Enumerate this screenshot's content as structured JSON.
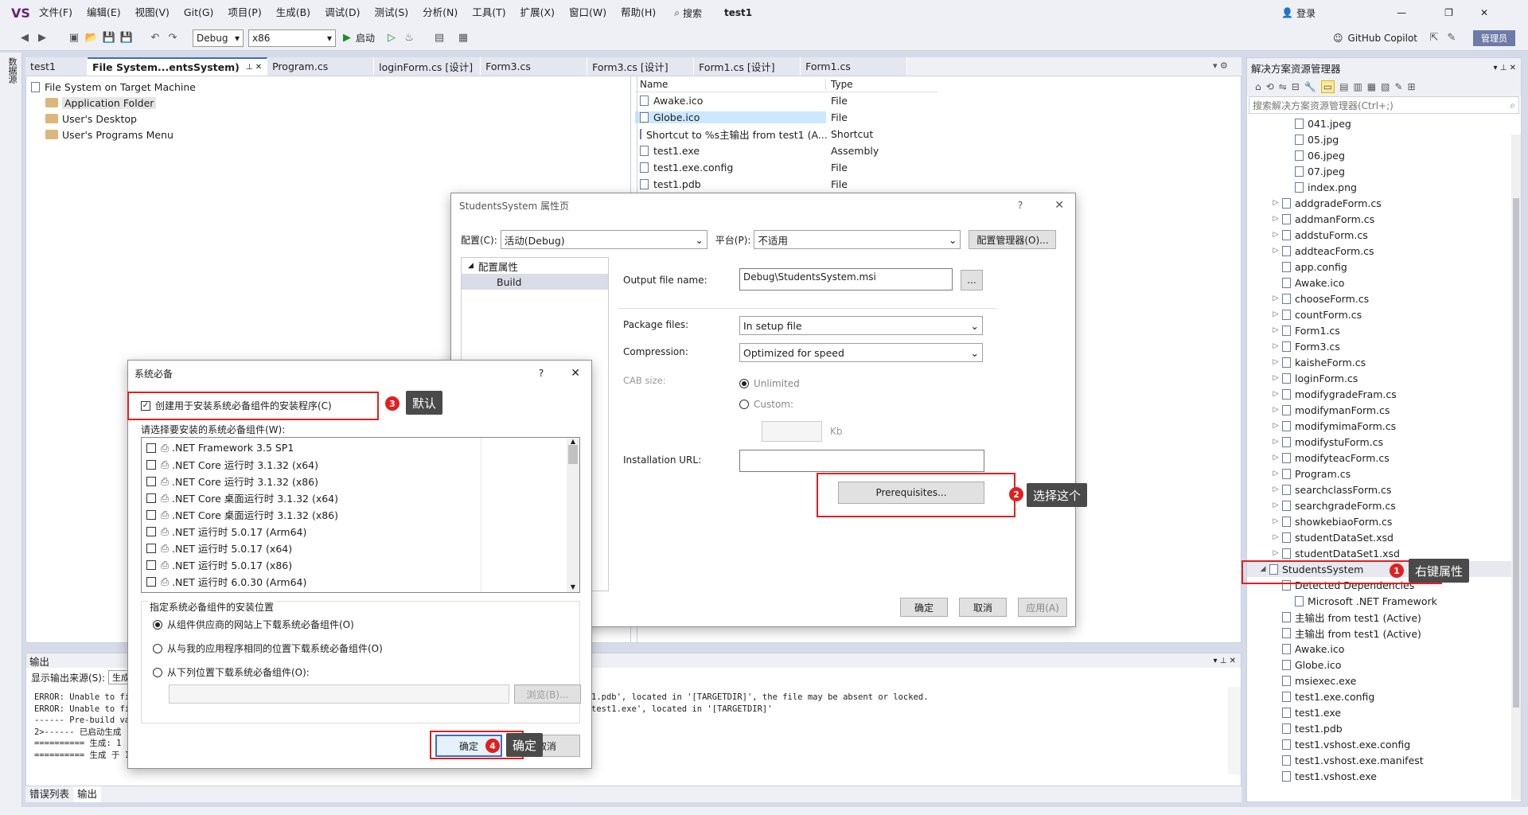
{
  "menubar": {
    "logo": "VS",
    "items": [
      "文件(F)",
      "编辑(E)",
      "视图(V)",
      "Git(G)",
      "项目(P)",
      "生成(B)",
      "调试(D)",
      "测试(S)",
      "分析(N)",
      "工具(T)",
      "扩展(X)",
      "窗口(W)",
      "帮助(H)"
    ],
    "search": "搜索",
    "solution_name": "test1",
    "login": "登录",
    "copilot": "GitHub Copilot",
    "admin": "管理员"
  },
  "toolbar": {
    "config": "Debug",
    "platform": "x86",
    "start": "启动"
  },
  "sidetab_label": "数据源",
  "doc_tabs": [
    {
      "label": "test1",
      "active": false
    },
    {
      "label": "File System...entsSystem)",
      "active": true
    },
    {
      "label": "Program.cs",
      "active": false
    },
    {
      "label": "loginForm.cs [设计]",
      "active": false
    },
    {
      "label": "Form3.cs",
      "active": false
    },
    {
      "label": "Form3.cs [设计]",
      "active": false
    },
    {
      "label": "Form1.cs [设计]",
      "active": false
    },
    {
      "label": "Form1.cs",
      "active": false
    }
  ],
  "fs_tree": {
    "root": "File System on Target Machine",
    "items": [
      "Application Folder",
      "User's Desktop",
      "User's Programs Menu"
    ]
  },
  "file_list": {
    "headers": [
      "Name",
      "Type"
    ],
    "rows": [
      {
        "name": "Awake.ico",
        "type": "File"
      },
      {
        "name": "Globe.ico",
        "type": "File"
      },
      {
        "name": "Shortcut to %s主输出 from test1 (A...",
        "type": "Shortcut"
      },
      {
        "name": "test1.exe",
        "type": "Assembly"
      },
      {
        "name": "test1.exe.config",
        "type": "File"
      },
      {
        "name": "test1.pdb",
        "type": "File"
      }
    ]
  },
  "props_dialog": {
    "title": "StudentsSystem 属性页",
    "help": "?",
    "close": "✕",
    "config_label": "配置(C):",
    "config_value": "活动(Debug)",
    "platform_label": "平台(P):",
    "platform_value": "不适用",
    "config_manager": "配置管理器(O)...",
    "tree_root": "配置属性",
    "tree_child": "Build",
    "output_label": "Output file name:",
    "output_value": "Debug\\StudentsSystem.msi",
    "browse": "...",
    "package_label": "Package files:",
    "package_value": "In setup file",
    "compression_label": "Compression:",
    "compression_value": "Optimized for speed",
    "cab_label": "CAB size:",
    "unlimited": "Unlimited",
    "custom": "Custom:",
    "kb": "Kb",
    "install_url_label": "Installation URL:",
    "prereq_button": "Prerequisites...",
    "ok": "确定",
    "cancel": "取消",
    "apply": "应用(A)"
  },
  "prereq_dialog": {
    "title": "系统必备",
    "help": "?",
    "close": "✕",
    "create_setup": "创建用于安装系统必备组件的安装程序(C)",
    "choose_label": "请选择要安装的系统必备组件(W):",
    "components": [
      ".NET Framework 3.5 SP1",
      ".NET Core 运行时 3.1.32 (x64)",
      ".NET Core 运行时 3.1.32 (x86)",
      ".NET Core 桌面运行时 3.1.32 (x64)",
      ".NET Core 桌面运行时 3.1.32 (x86)",
      ".NET 运行时 5.0.17 (Arm64)",
      ".NET 运行时 5.0.17 (x64)",
      ".NET 运行时 5.0.17 (x86)",
      ".NET 运行时 6.0.30 (Arm64)"
    ],
    "location_group": "指定系统必备组件的安装位置",
    "opt1": "从组件供应商的网站上下载系统必备组件(O)",
    "opt2": "从与我的应用程序相同的位置下载系统必备组件(O)",
    "opt3": "从下列位置下载系统必备组件(O):",
    "browse": "浏览(B)...",
    "ok": "确定",
    "cancel": "取消"
  },
  "output": {
    "title": "输出",
    "source_label": "显示输出来源(S):",
    "source_value": "生成",
    "lines_left": [
      "ERROR: Unable to fin",
      "ERROR: Unable to fin",
      "------ Pre-build val",
      "2>------ 已启动生成",
      "========== 生成: 1 ",
      "========== 生成 于 1"
    ],
    "lines_right": [
      "1.pdb', located in '[TARGETDIR]', the file may be absent or locked.",
      "test1.exe', located in '[TARGETDIR]'"
    ]
  },
  "bottom_tabs": [
    "错误列表",
    "输出"
  ],
  "solution_explorer": {
    "title": "解决方案资源管理器",
    "search_placeholder": "搜索解决方案资源管理器(Ctrl+;)",
    "items": [
      {
        "label": "041.jpeg",
        "level": 3,
        "expand": false
      },
      {
        "label": "05.jpg",
        "level": 3,
        "expand": false
      },
      {
        "label": "06.jpeg",
        "level": 3,
        "expand": false
      },
      {
        "label": "07.jpeg",
        "level": 3,
        "expand": false
      },
      {
        "label": "index.png",
        "level": 3,
        "expand": false
      },
      {
        "label": "addgradeForm.cs",
        "level": 2,
        "expand": true
      },
      {
        "label": "addmanForm.cs",
        "level": 2,
        "expand": true
      },
      {
        "label": "addstuForm.cs",
        "level": 2,
        "expand": true
      },
      {
        "label": "addteacForm.cs",
        "level": 2,
        "expand": true
      },
      {
        "label": "app.config",
        "level": 2,
        "expand": false
      },
      {
        "label": "Awake.ico",
        "level": 2,
        "expand": false
      },
      {
        "label": "chooseForm.cs",
        "level": 2,
        "expand": true
      },
      {
        "label": "countForm.cs",
        "level": 2,
        "expand": true
      },
      {
        "label": "Form1.cs",
        "level": 2,
        "expand": true
      },
      {
        "label": "Form3.cs",
        "level": 2,
        "expand": true
      },
      {
        "label": "kaisheForm.cs",
        "level": 2,
        "expand": true
      },
      {
        "label": "loginForm.cs",
        "level": 2,
        "expand": true
      },
      {
        "label": "modifygradeFram.cs",
        "level": 2,
        "expand": true
      },
      {
        "label": "modifymanForm.cs",
        "level": 2,
        "expand": true
      },
      {
        "label": "modifymimaForm.cs",
        "level": 2,
        "expand": true
      },
      {
        "label": "modifystuForm.cs",
        "level": 2,
        "expand": true
      },
      {
        "label": "modifyteacForm.cs",
        "level": 2,
        "expand": true
      },
      {
        "label": "Program.cs",
        "level": 2,
        "expand": true
      },
      {
        "label": "searchclassForm.cs",
        "level": 2,
        "expand": true
      },
      {
        "label": "searchgradeForm.cs",
        "level": 2,
        "expand": true
      },
      {
        "label": "showkebiaoForm.cs",
        "level": 2,
        "expand": true
      },
      {
        "label": "studentDataSet.xsd",
        "level": 2,
        "expand": true
      },
      {
        "label": "studentDataSet1.xsd",
        "level": 2,
        "expand": true
      },
      {
        "label": "StudentsSystem",
        "level": 1,
        "expand": true
      },
      {
        "label": "Detected Dependencies",
        "level": 2,
        "expand": false
      },
      {
        "label": "Microsoft .NET Framework",
        "level": 3,
        "expand": false
      },
      {
        "label": "主输出 from test1 (Active)",
        "level": 2,
        "expand": false
      },
      {
        "label": "主输出 from test1 (Active)",
        "level": 2,
        "expand": false
      },
      {
        "label": "Awake.ico",
        "level": 2,
        "expand": false
      },
      {
        "label": "Globe.ico",
        "level": 2,
        "expand": false
      },
      {
        "label": "msiexec.exe",
        "level": 2,
        "expand": false
      },
      {
        "label": "test1.exe.config",
        "level": 2,
        "expand": false
      },
      {
        "label": "test1.exe",
        "level": 2,
        "expand": false
      },
      {
        "label": "test1.pdb",
        "level": 2,
        "expand": false
      },
      {
        "label": "test1.vshost.exe.config",
        "level": 2,
        "expand": false
      },
      {
        "label": "test1.vshost.exe.manifest",
        "level": 2,
        "expand": false
      },
      {
        "label": "test1.vshost.exe",
        "level": 2,
        "expand": false
      }
    ]
  },
  "annotations": {
    "n1": "1",
    "c1": "右键属性",
    "n2": "2",
    "c2": "选择这个",
    "n3": "3",
    "c3": "默认",
    "n4": "4",
    "c4": "确定"
  },
  "colors": {
    "annotation_red": "#e02020",
    "callout_bg": "#4a4a4a",
    "accent_blue": "#3c6bc6"
  }
}
